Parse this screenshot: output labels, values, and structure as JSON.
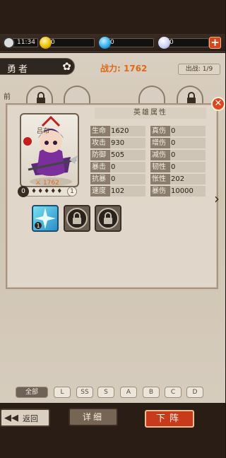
{
  "resources": {
    "clock": "11:34",
    "gold": "0",
    "gems": "0",
    "pearls": "0"
  },
  "header": {
    "team_tab": "勇者",
    "power_label": "战力:",
    "power_value": "1762",
    "deploy_count": "出战: 1/9",
    "front_row_label": "前"
  },
  "hero": {
    "name": "吕布",
    "power": "1762",
    "level": "0",
    "star_count": "1",
    "stars": "♦♦♦♦♦"
  },
  "attributes": {
    "title": "英雄属性",
    "rows": [
      {
        "label": "生命",
        "value": "1620",
        "label2": "真伤",
        "value2": "0"
      },
      {
        "label": "攻击",
        "value": "930",
        "label2": "增伤",
        "value2": "0"
      },
      {
        "label": "防御",
        "value": "505",
        "label2": "减伤",
        "value2": "0"
      },
      {
        "label": "暴击",
        "value": "0",
        "label2": "韧性",
        "value2": "0"
      },
      {
        "label": "抗暴",
        "value": "0",
        "label2": "怅性",
        "value2": "202"
      },
      {
        "label": "速度",
        "value": "102",
        "label2": "暴伤",
        "value2": "10000"
      }
    ]
  },
  "filters": [
    "全部",
    "L",
    "SS",
    "S",
    "A",
    "B",
    "C",
    "D"
  ],
  "buttons": {
    "back": "返回",
    "detail": "详细",
    "remove": "下阵"
  },
  "icons": {
    "close": "close-icon",
    "lock": "lock-icon",
    "arrow_right": "chevron-right-icon",
    "back_arrow": "back-arrow-icon"
  }
}
